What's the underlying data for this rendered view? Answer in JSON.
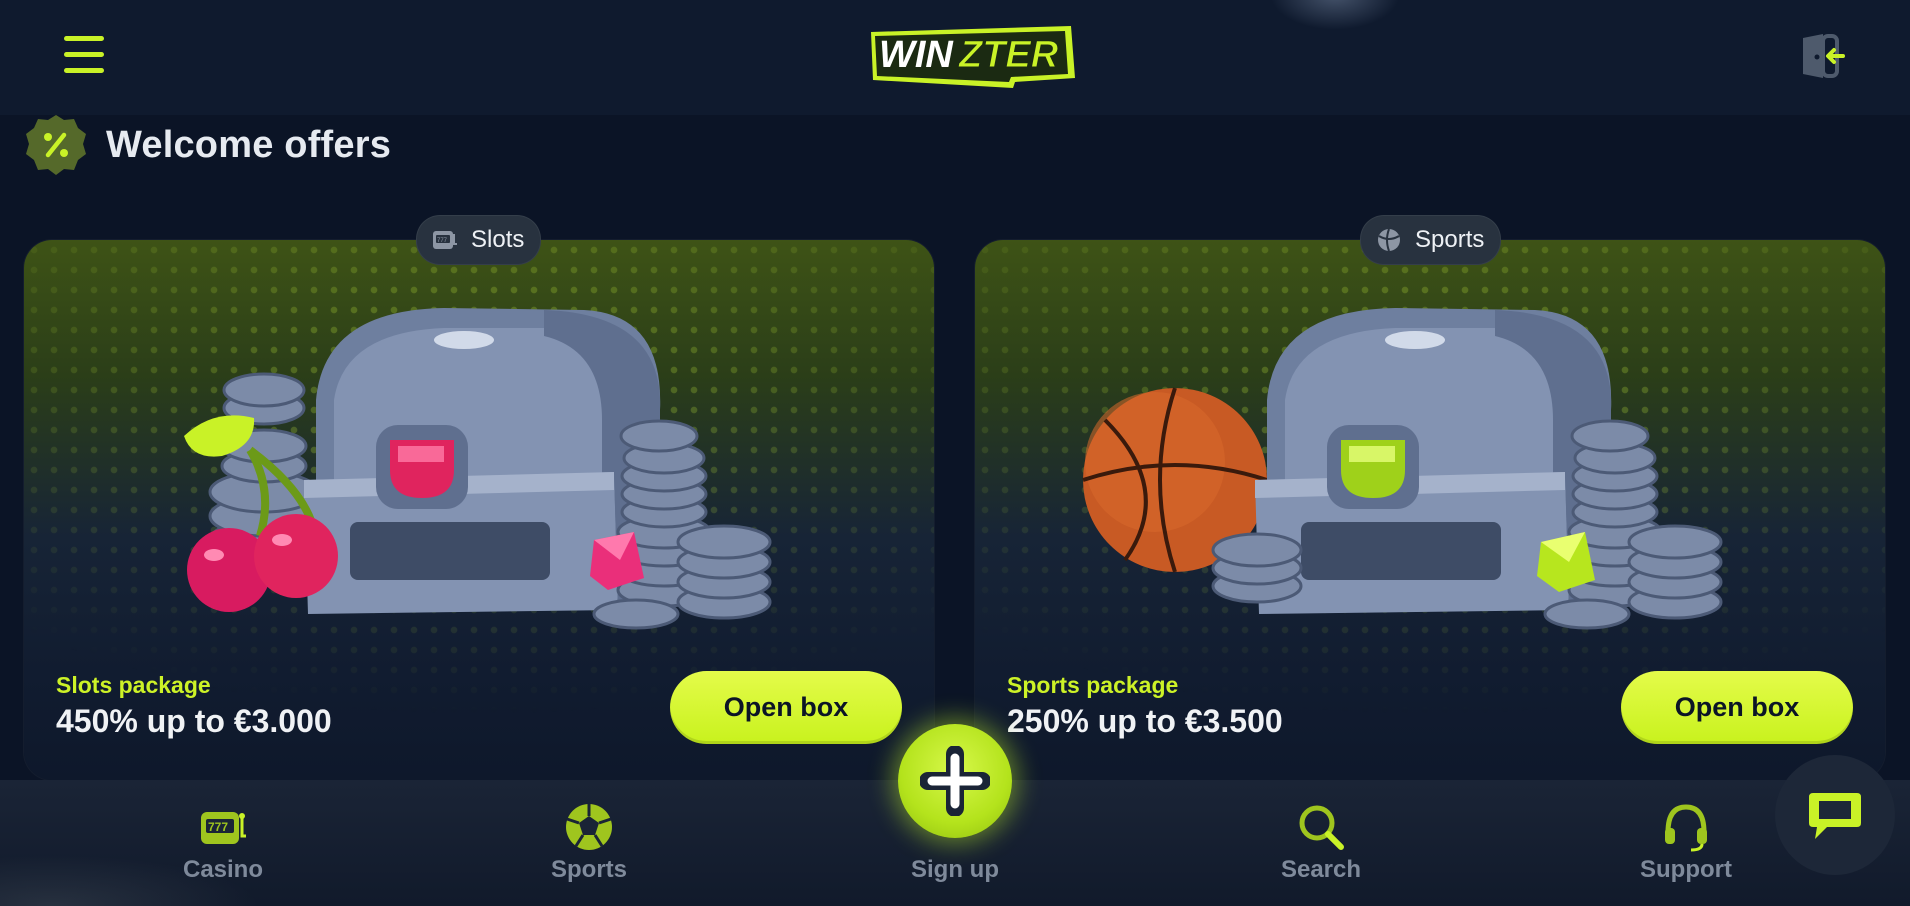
{
  "brand": {
    "logo_text_1": "WIN",
    "logo_text_2": "ZTER",
    "accent": "#c9f227",
    "background": "#0b1426"
  },
  "header": {
    "menu_icon": "hamburger-icon",
    "logout_icon": "logout-icon"
  },
  "section": {
    "title": "Welcome offers",
    "icon": "percent-badge-icon"
  },
  "offers": [
    {
      "tag": "Slots",
      "tag_icon": "slot-machine-icon",
      "label": "Slots package",
      "value": "450% up to €3.000",
      "button": "Open box",
      "image": "treasure-chest-cherries-coins"
    },
    {
      "tag": "Sports",
      "tag_icon": "ball-icon",
      "label": "Sports package",
      "value": "250% up to €3.500",
      "button": "Open box",
      "image": "treasure-chest-basketball-coins"
    }
  ],
  "bottom_nav": {
    "items": [
      {
        "label": "Casino",
        "icon": "slot-777-icon"
      },
      {
        "label": "Sports",
        "icon": "soccer-ball-icon"
      },
      {
        "label": "Sign up",
        "icon": "plus-icon"
      },
      {
        "label": "Search",
        "icon": "search-icon"
      },
      {
        "label": "Support",
        "icon": "headset-icon"
      }
    ]
  },
  "chat": {
    "icon": "chat-bubble-icon"
  }
}
